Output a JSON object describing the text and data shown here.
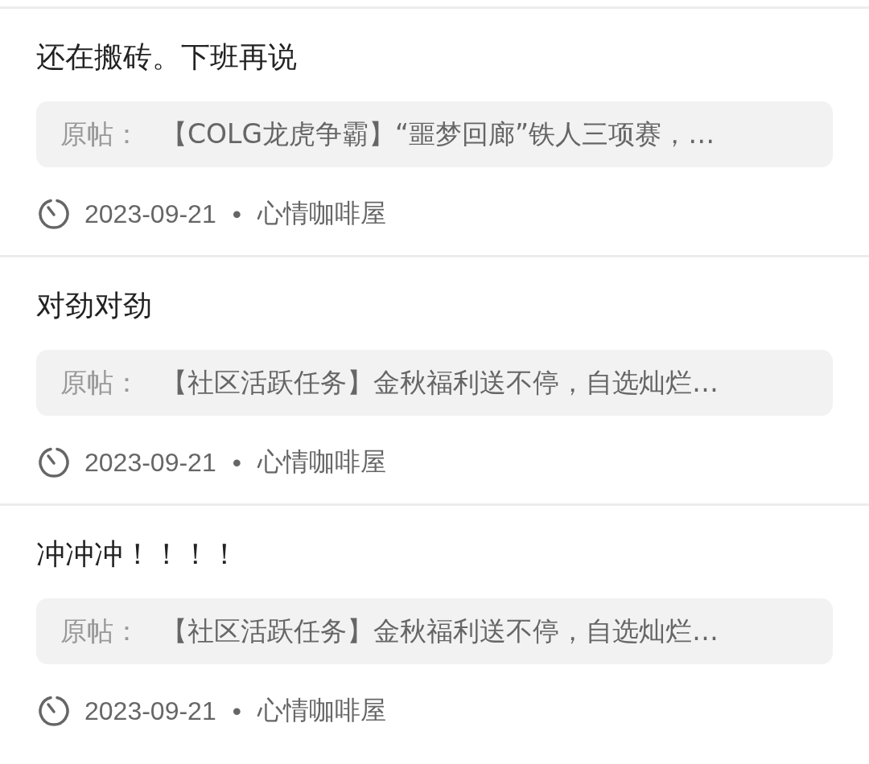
{
  "replies": [
    {
      "text": "还在搬砖。下班再说",
      "quote_label": "原帖：",
      "quote_title": "【COLG龙虎争霸】“噩梦回廊”铁人三项赛，…",
      "date": "2023-09-21",
      "separator": "•",
      "forum": "心情咖啡屋"
    },
    {
      "text": "对劲对劲",
      "quote_label": "原帖：",
      "quote_title": "【社区活跃任务】金秋福利送不停，自选灿烂…",
      "date": "2023-09-21",
      "separator": "•",
      "forum": "心情咖啡屋"
    },
    {
      "text": "冲冲冲！！！！",
      "quote_label": "原帖：",
      "quote_title": "【社区活跃任务】金秋福利送不停，自选灿烂…",
      "date": "2023-09-21",
      "separator": "•",
      "forum": "心情咖啡屋"
    }
  ]
}
